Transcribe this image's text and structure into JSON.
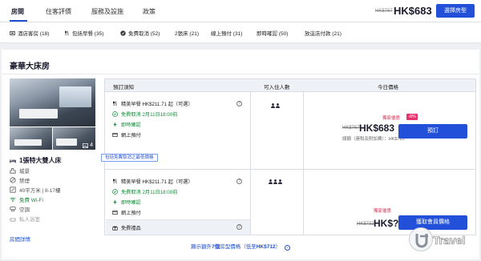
{
  "tabs": [
    {
      "label": "房間",
      "active": true
    },
    {
      "label": "住客評價"
    },
    {
      "label": "服務及設施"
    },
    {
      "label": "政策"
    }
  ],
  "header": {
    "old_price": "HK$767",
    "price": "HK$683",
    "select_room_label": "選擇房型"
  },
  "filters": [
    {
      "label": "酒店客房 (18)",
      "icon": "room-icon"
    },
    {
      "label": "包括早餐 (35)",
      "icon": "fork-knife-icon"
    },
    {
      "label": "免費取消 (52)",
      "icon": "check-circle-icon"
    },
    {
      "label": "2張床 (21)"
    },
    {
      "label": "線上預付 (31)"
    },
    {
      "label": "即時確認 (50)"
    },
    {
      "label": "放這店付款 (21)"
    }
  ],
  "room": {
    "title": "豪華大床房",
    "photo_count": "4",
    "features": [
      {
        "label": "1張特大雙人床",
        "icon": "bed-icon",
        "style": "big"
      },
      {
        "label": "城景",
        "icon": "city-icon"
      },
      {
        "label": "禁煙",
        "icon": "no-smoking-icon"
      },
      {
        "label": "40平方米 | 8-17樓",
        "icon": "size-icon"
      },
      {
        "label": "免費 Wi-Fi",
        "icon": "wifi-icon",
        "style": "green"
      },
      {
        "label": "空調",
        "icon": "aircon-icon"
      },
      {
        "label": "私人浴室",
        "icon": "bath-icon",
        "style": "faded"
      }
    ],
    "details_link": "房間詳情"
  },
  "table": {
    "headers": [
      "預訂須知",
      "可入住人數",
      "今日價格"
    ],
    "offers": [
      {
        "breakfast": "精美早餐 HK$211.71 起（可選）",
        "cancel": "免費取消 2月11日18:00前",
        "confirm": "即時確認",
        "pay": "網上預付",
        "guests": 2,
        "promo": "獨家優惠",
        "promo_pct": "-8%",
        "old_price": "HK$767",
        "price": "HK$683",
        "note": "總額（連稅及附加費）：HK$785",
        "book_label": "預訂"
      },
      {
        "breakfast": "精美早餐 HK$211.71 起（可選）",
        "cancel": "免費取消 2月11日18:00前",
        "confirm": "即時確認",
        "pay": "網上預付",
        "gift": "免費禮品",
        "guests": 3,
        "promo": "獨家優惠",
        "old_price": "HK$732",
        "price": "HK$?",
        "book_label": "獲取會員價格"
      }
    ],
    "free_cancel_tag": "包括免費取消之最低價格"
  },
  "more_prices": {
    "prefix": "顯示額外",
    "count": "7個",
    "middle": "房型價格（低至",
    "price": "HK$712",
    "suffix": "）"
  },
  "watermark": "Travel"
}
